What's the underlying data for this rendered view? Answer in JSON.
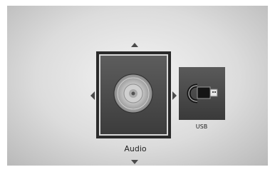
{
  "menu": {
    "items": [
      {
        "label": "Audio",
        "icon": "disc-icon",
        "selected": true
      },
      {
        "label": "USB",
        "icon": "usb-icon",
        "selected": false
      }
    ]
  },
  "colors": {
    "tile_dark": "#3c3c3c",
    "selection_border": "#d9d9d9",
    "background_light": "#f3f3f3"
  }
}
